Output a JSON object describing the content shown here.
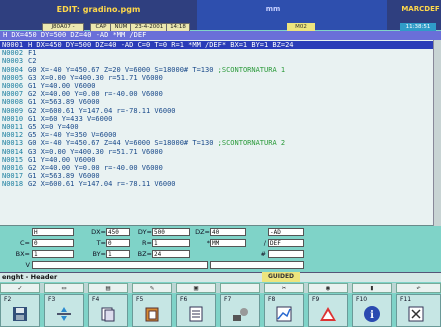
{
  "window": {
    "title": "EDIT: gradino.pgm",
    "mode_label": "mm",
    "machine_name": "MARCDEF",
    "right_time": "11:38:51",
    "m_code": "M02"
  },
  "status_fields": {
    "name": "J80A07 -",
    "caps": "CAP",
    "num": "NUM",
    "date": "23-4-2001",
    "time": "14:18"
  },
  "header_line": "H DX=450 DY=500 DZ=40 -AD *MM /DEF",
  "editor_lines": [
    {
      "n": "N0001",
      "code": "H DX=450 DY=500 DZ=40 -AD C=0 T=0 R=1 *MM /DEF* BX=1 BY=1 BZ=24",
      "comment": "",
      "selected": true
    },
    {
      "n": "N0002",
      "code": "F1",
      "comment": "",
      "selected": false
    },
    {
      "n": "N0003",
      "code": "C2",
      "comment": "",
      "selected": false
    },
    {
      "n": "N0004",
      "code": "G0 X=-40 Y=450.67 Z=20 V=6000 S=18000# T=130 ",
      "comment": ";SCONTORNATURA 1",
      "selected": false
    },
    {
      "n": "N0005",
      "code": "G3 X=0.00 Y=400.30 r=51.71 V6000",
      "comment": "",
      "selected": false
    },
    {
      "n": "N0006",
      "code": "G1 Y=40.00 V6000",
      "comment": "",
      "selected": false
    },
    {
      "n": "N0007",
      "code": "G2 X=40.00 Y=0.00 r=-40.00 V6000",
      "comment": "",
      "selected": false
    },
    {
      "n": "N0008",
      "code": "G1 X=563.89 V6000",
      "comment": "",
      "selected": false
    },
    {
      "n": "N0009",
      "code": "G2 X=600.61 Y=147.04 r=-78.11 V6000",
      "comment": "",
      "selected": false
    },
    {
      "n": "N0010",
      "code": "G1 X=60 Y=433 V=6000",
      "comment": "",
      "selected": false
    },
    {
      "n": "N0011",
      "code": "G5 X=0 Y=400",
      "comment": "",
      "selected": false
    },
    {
      "n": "N0012",
      "code": "G5 X=-40 Y=350 V=6000",
      "comment": "",
      "selected": false
    },
    {
      "n": "N0013",
      "code": "G0 X=-40 Y=450.67 Z=44 V=6000 S=18000# T=130 ",
      "comment": ";SCONTORNATURA 2",
      "selected": false
    },
    {
      "n": "N0014",
      "code": "G3 X=0.00 Y=400.30 r=51.71 V6000",
      "comment": "",
      "selected": false
    },
    {
      "n": "N0015",
      "code": "G1 Y=40.00 V6000",
      "comment": "",
      "selected": false
    },
    {
      "n": "N0016",
      "code": "G2 X=40.00 Y=0.00 r=-40.00 V6000",
      "comment": "",
      "selected": false
    },
    {
      "n": "N0017",
      "code": "G1 X=563.89 V6000",
      "comment": "",
      "selected": false
    },
    {
      "n": "N0018",
      "code": "G2 X=600.61 Y=147.04 r=-78.11 V6000",
      "comment": "",
      "selected": false
    }
  ],
  "params": {
    "h_value": "H",
    "dx_label": "DX=",
    "dx_value": "450",
    "dy_label": "DY=",
    "dy_value": "500",
    "dz_label": "DZ=",
    "dz_value": "40",
    "ad_value": "-AD",
    "c_label": "C=",
    "c_value": "0",
    "t_label": "T=",
    "t_value": "0",
    "r_label": "R=",
    "r_value": "1",
    "mm_label": "*",
    "mm_value": "MM",
    "def_label": "/",
    "def_value": "DEF",
    "bx_label": "BX=",
    "bx_value": "1",
    "by_label": "BY=",
    "by_value": "1",
    "bz_label": "BZ=",
    "bz_value": "24",
    "hash_label": "#",
    "v_label": "V"
  },
  "status_bar": {
    "text": "enght - Header",
    "guided": "GUIDED"
  },
  "softkeys": [
    {
      "key": "F2",
      "icon": "save-icon"
    },
    {
      "key": "F3",
      "icon": "cut-icon"
    },
    {
      "key": "F4",
      "icon": "copy-icon"
    },
    {
      "key": "F5",
      "icon": "paste-icon"
    },
    {
      "key": "F6",
      "icon": "list-icon"
    },
    {
      "key": "F7",
      "icon": "tools-icon"
    },
    {
      "key": "F8",
      "icon": "graphic-icon"
    },
    {
      "key": "F9",
      "icon": "warning-icon"
    },
    {
      "key": "F10",
      "icon": "info-icon"
    },
    {
      "key": "F11",
      "icon": "exit-icon"
    }
  ]
}
